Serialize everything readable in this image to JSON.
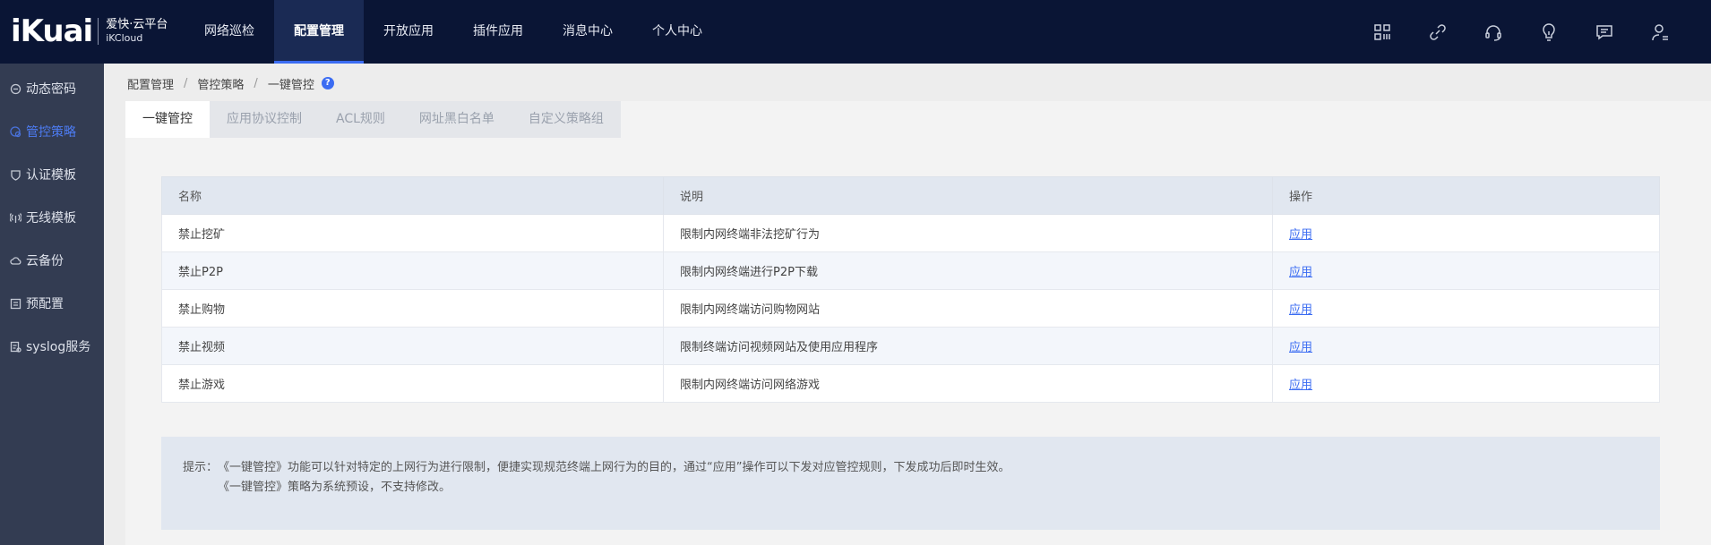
{
  "logo": {
    "main": "iKuai",
    "line1": "爱快·云平台",
    "line2": "iKCloud"
  },
  "nav": [
    {
      "label": "网络巡检",
      "active": false
    },
    {
      "label": "配置管理",
      "active": true
    },
    {
      "label": "开放应用",
      "active": false
    },
    {
      "label": "插件应用",
      "active": false
    },
    {
      "label": "消息中心",
      "active": false
    },
    {
      "label": "个人中心",
      "active": false
    }
  ],
  "top_icons": [
    "grid-icon",
    "link-icon",
    "headset-icon",
    "bulb-icon",
    "message-icon",
    "user-icon"
  ],
  "sidebar": [
    {
      "label": "动态密码",
      "icon": "key-icon",
      "active": false
    },
    {
      "label": "管控策略",
      "icon": "policy-icon",
      "active": true
    },
    {
      "label": "认证模板",
      "icon": "shield-icon",
      "active": false
    },
    {
      "label": "无线模板",
      "icon": "wireless-icon",
      "active": false
    },
    {
      "label": "云备份",
      "icon": "cloud-icon",
      "active": false
    },
    {
      "label": "预配置",
      "icon": "list-icon",
      "active": false
    },
    {
      "label": "syslog服务",
      "icon": "log-icon",
      "active": false
    }
  ],
  "breadcrumb": [
    "配置管理",
    "管控策略",
    "一键管控"
  ],
  "tabs": [
    {
      "label": "一键管控",
      "active": true
    },
    {
      "label": "应用协议控制",
      "active": false
    },
    {
      "label": "ACL规则",
      "active": false
    },
    {
      "label": "网址黑白名单",
      "active": false
    },
    {
      "label": "自定义策略组",
      "active": false
    }
  ],
  "table": {
    "headers": [
      "名称",
      "说明",
      "操作"
    ],
    "rows": [
      {
        "name": "禁止挖矿",
        "desc": "限制内网终端非法挖矿行为",
        "action": "应用"
      },
      {
        "name": "禁止P2P",
        "desc": "限制内网终端进行P2P下载",
        "action": "应用"
      },
      {
        "name": "禁止购物",
        "desc": "限制内网终端访问购物网站",
        "action": "应用"
      },
      {
        "name": "禁止视频",
        "desc": "限制终端访问视频网站及使用应用程序",
        "action": "应用"
      },
      {
        "name": "禁止游戏",
        "desc": "限制内网终端访问网络游戏",
        "action": "应用"
      }
    ]
  },
  "tip": {
    "label": "提示：",
    "line1": "《一键管控》功能可以针对特定的上网行为进行限制，便捷实现规范终端上网行为的目的，通过“应用”操作可以下发对应管控规则，下发成功后即时生效。",
    "line2": "《一键管控》策略为系统预设，不支持修改。"
  },
  "colors": {
    "topbar": "#0a1535",
    "sidebar": "#333c52",
    "accent": "#3b6cf2"
  }
}
